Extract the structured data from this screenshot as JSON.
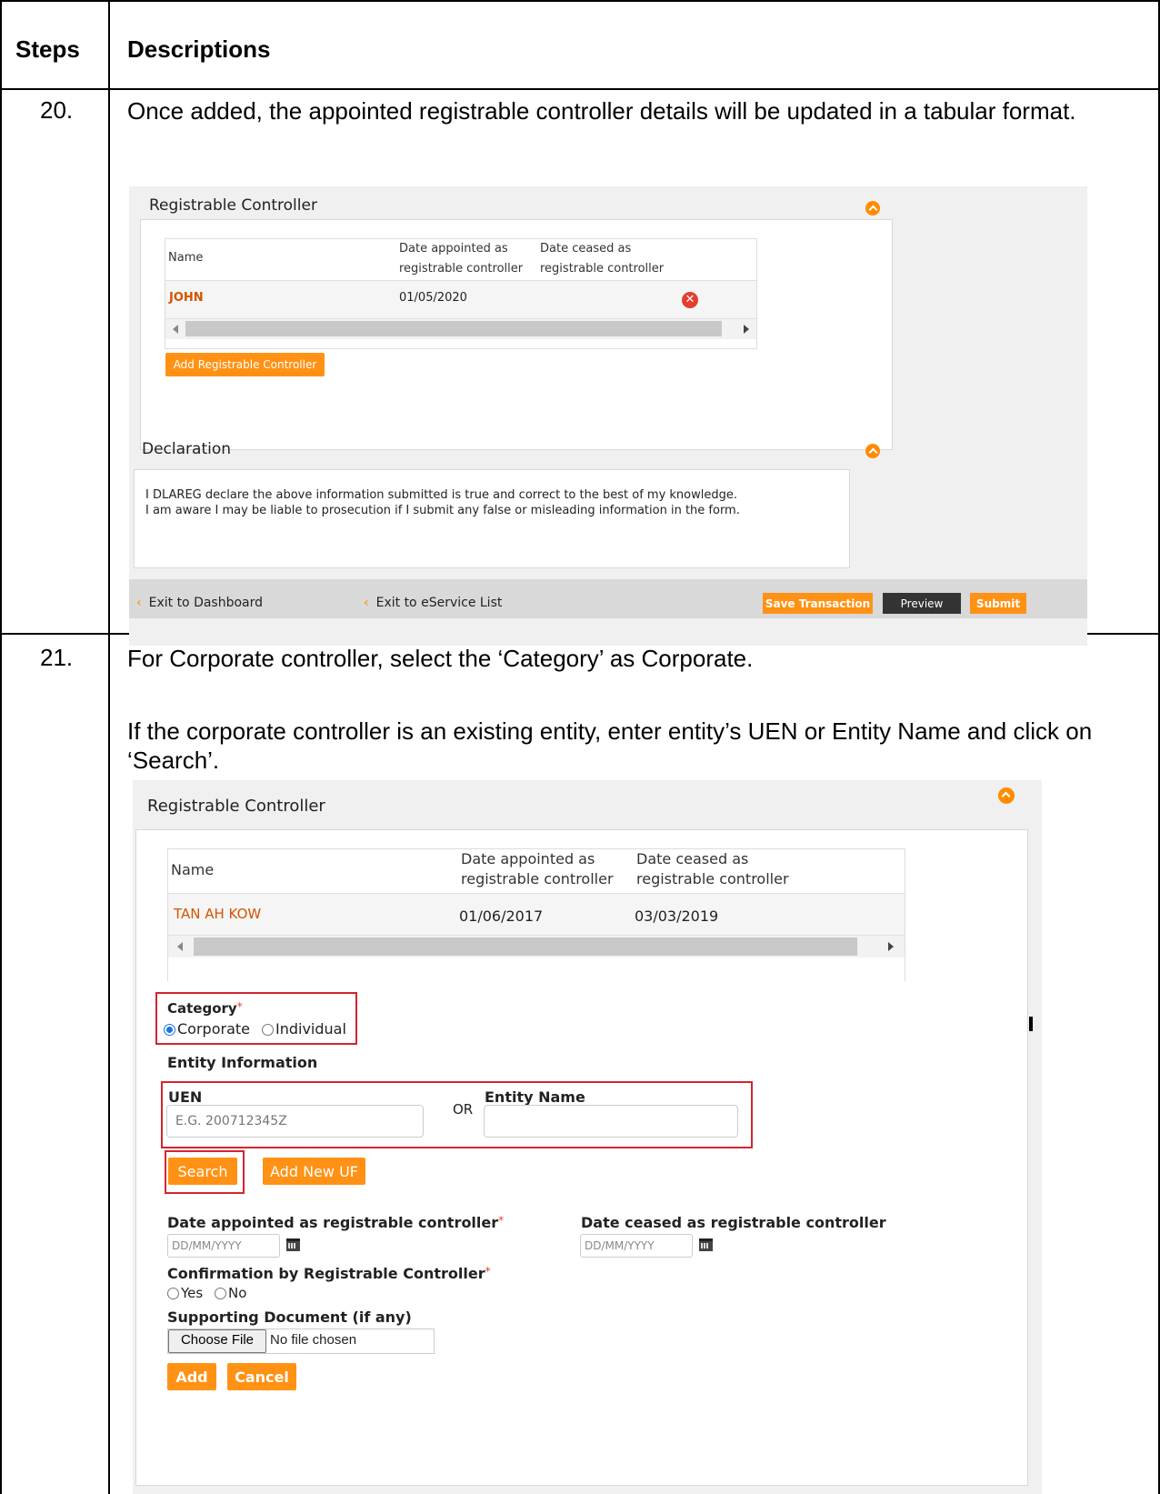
{
  "header": {
    "steps": "Steps",
    "descriptions": "Descriptions"
  },
  "step20": {
    "number": "20.",
    "text": "Once added, the appointed registrable controller details will be updated in a tabular format.",
    "screenshot": {
      "section_title": "Registrable Controller",
      "columns": {
        "name": "Name",
        "appointed": "Date appointed as registrable controller",
        "ceased": "Date ceased as registrable controller"
      },
      "row": {
        "name": "JOHN",
        "appointed": "01/05/2020",
        "ceased": ""
      },
      "add_button": "Add Registrable Controller",
      "declaration_title": "Declaration",
      "declaration_line1": "I DLAREG  declare the above information submitted is true and correct to the best of my knowledge.",
      "declaration_line2": "I am aware I may be liable to prosecution if I submit any false or misleading information in the form.",
      "footer": {
        "exit_dashboard": "Exit to Dashboard",
        "exit_eservice": "Exit to eService List",
        "save": "Save Transaction",
        "preview": "Preview",
        "submit": "Submit"
      }
    }
  },
  "step21": {
    "number": "21.",
    "text1": "For Corporate controller, select the ‘Category’ as Corporate.",
    "text2": "If the corporate controller is an existing entity, enter entity’s UEN or Entity Name and click on ‘Search’.",
    "screenshot": {
      "section_title": "Registrable Controller",
      "columns": {
        "name": "Name",
        "appointed": "Date appointed as registrable controller",
        "ceased": "Date ceased as registrable controller"
      },
      "row": {
        "name": "TAN AH KOW",
        "appointed": "01/06/2017",
        "ceased": "03/03/2019"
      },
      "category_label": "Category",
      "category_options": [
        "Corporate",
        "Individual"
      ],
      "category_selected": "Corporate",
      "entity_info": "Entity Information",
      "uen_label": "UEN",
      "uen_placeholder": "E.G. 200712345Z",
      "or_text": "OR",
      "entity_name_label": "Entity Name",
      "entity_name_value": "",
      "search_button": "Search",
      "add_new_button": "Add New UF",
      "appointed_label": "Date appointed as registrable controller",
      "ceased_label": "Date ceased as registrable controller",
      "date_placeholder": "DD/MM/YYYY",
      "confirmation_label": "Confirmation by Registrable Controller",
      "confirmation_options": [
        "Yes",
        "No"
      ],
      "supporting_label": "Supporting Document (if any)",
      "choose_file": "Choose File",
      "no_file": "No file chosen",
      "add_button": "Add",
      "cancel_button": "Cancel"
    }
  },
  "colors": {
    "accent_orange": "#ff9214",
    "link_orange": "#d35400",
    "highlight_red": "#d4242f",
    "radio_blue": "#1a73e8"
  }
}
